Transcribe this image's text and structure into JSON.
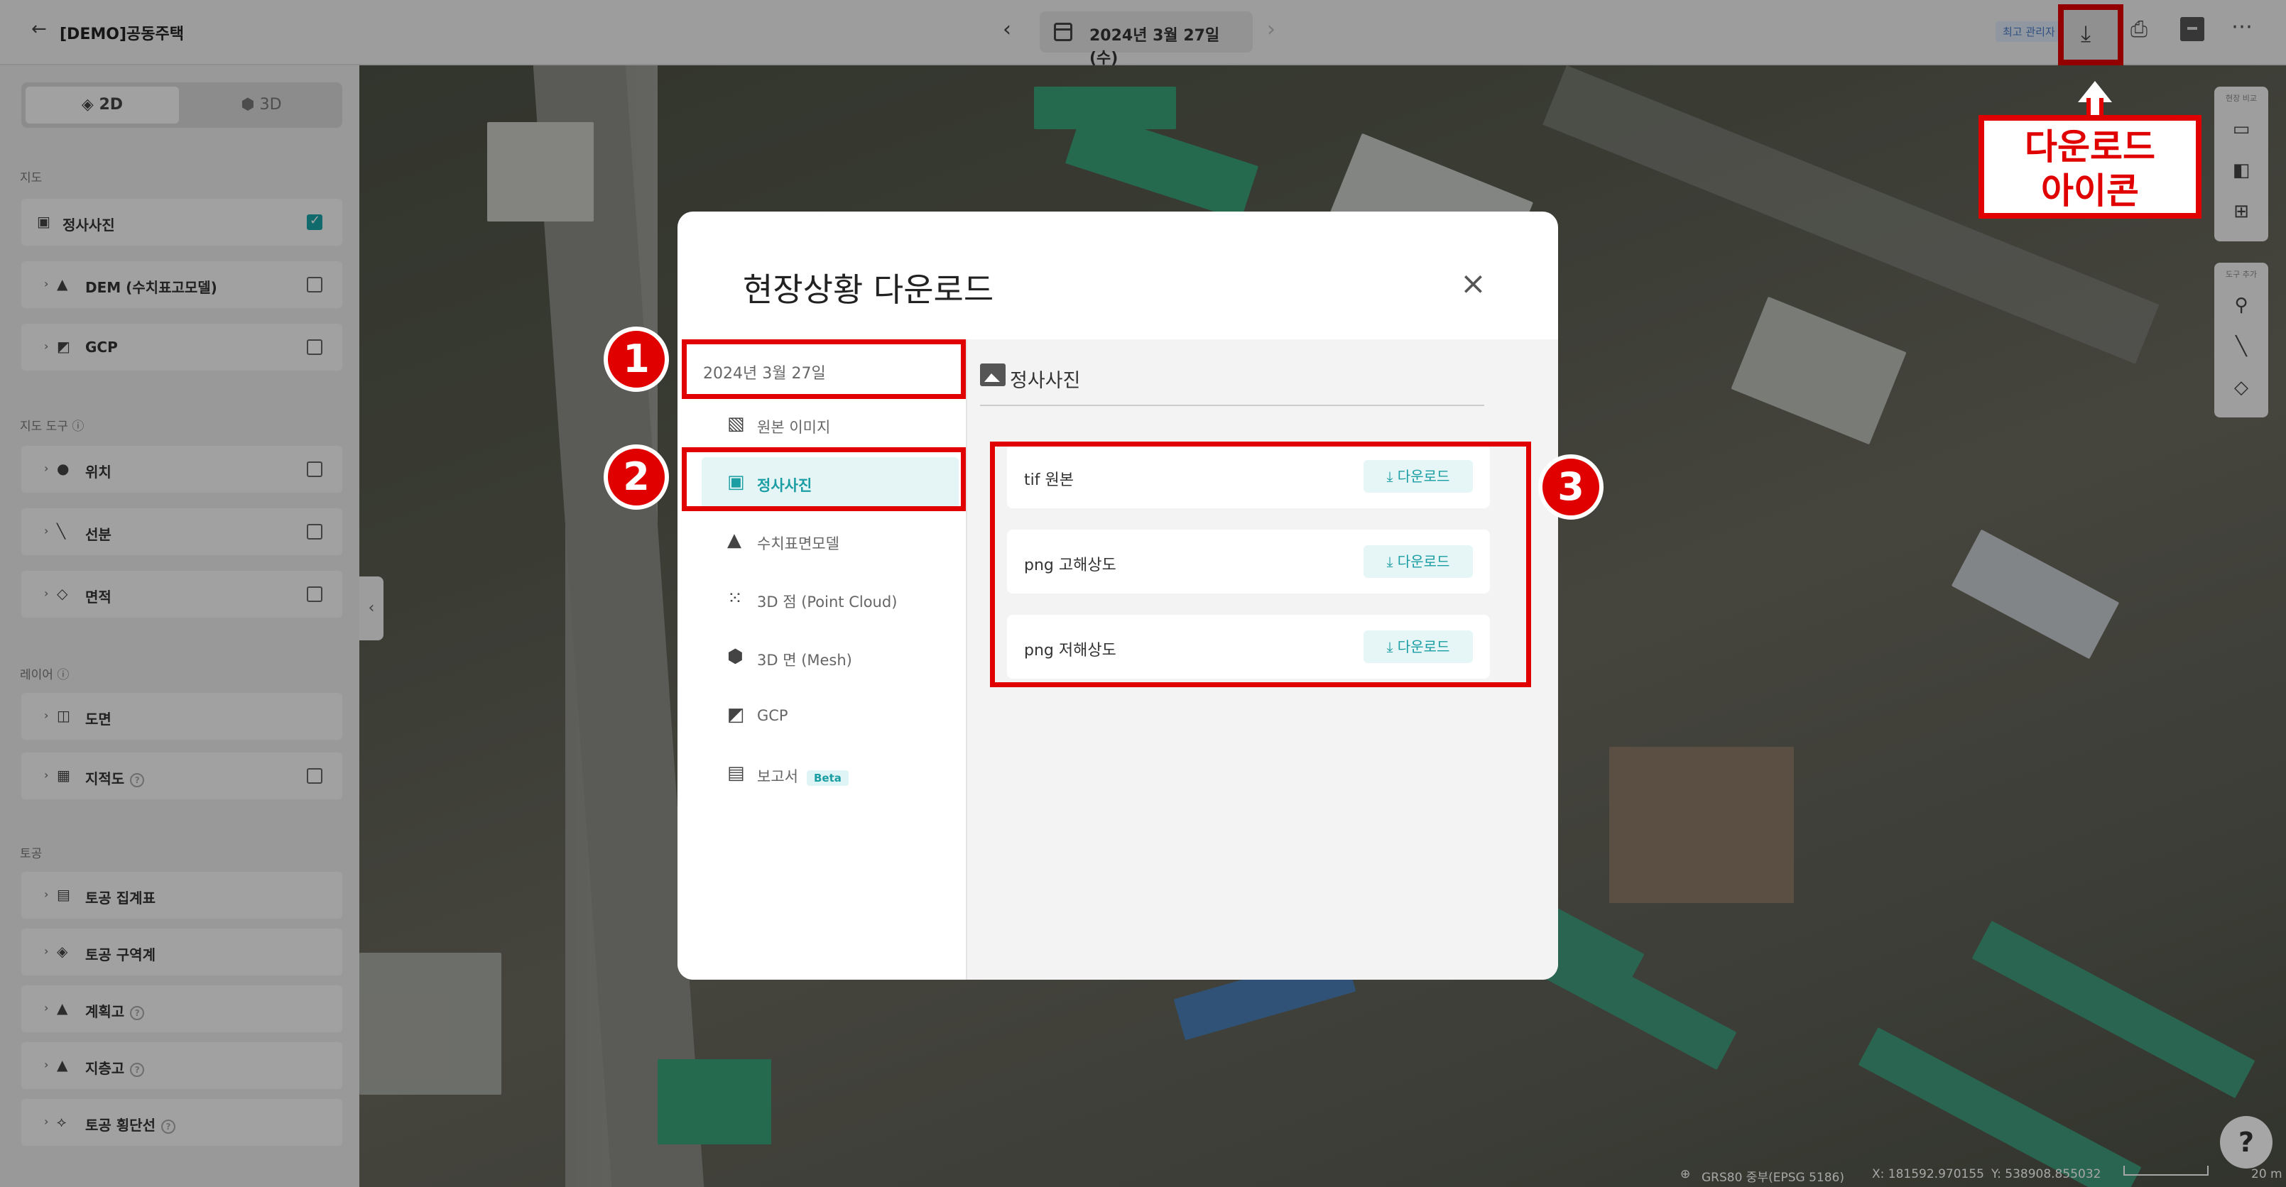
{
  "topbar": {
    "back_icon": "arrow-left-icon",
    "project_title": "[DEMO]공동주택",
    "date": "2024년 3월 27일 (수)",
    "chip": "최고 관리자"
  },
  "callout": {
    "line1": "다운로드",
    "line2": "아이콘"
  },
  "sidebar": {
    "view_2d": "2D",
    "view_3d": "3D",
    "map_section": "지도",
    "map_items": [
      {
        "label": "정사사진",
        "checked": true
      },
      {
        "label": "DEM (수치표고모델)",
        "checked": false
      },
      {
        "label": "GCP",
        "checked": false
      }
    ],
    "tools_section": "지도 도구",
    "tool_items": [
      {
        "label": "위치"
      },
      {
        "label": "선분"
      },
      {
        "label": "면적"
      }
    ],
    "layer_section": "레이어",
    "layer_items": [
      {
        "label": "도면"
      },
      {
        "label": "지적도"
      }
    ],
    "earthwork_section": "토공",
    "earthwork_items": [
      {
        "label": "토공 집계표"
      },
      {
        "label": "토공 구역계"
      },
      {
        "label": "계획고"
      },
      {
        "label": "지층고"
      },
      {
        "label": "토공 횡단선"
      }
    ]
  },
  "right_tools": {
    "compare_title": "현장 비교",
    "tool_title": "도구 추가"
  },
  "modal": {
    "title": "현장상황 다운로드",
    "date": "2024년 3월 27일",
    "nav": [
      {
        "label": "원본 이미지",
        "icon": "images-icon"
      },
      {
        "label": "정사사진",
        "icon": "image-icon",
        "active": true
      },
      {
        "label": "수치표면모델",
        "icon": "mountain-icon"
      },
      {
        "label": "3D 점 (Point Cloud)",
        "icon": "point-cloud-icon"
      },
      {
        "label": "3D 면 (Mesh)",
        "icon": "cube-icon"
      },
      {
        "label": "GCP",
        "icon": "gcp-icon"
      },
      {
        "label": "보고서",
        "icon": "document-icon",
        "badge": "Beta"
      }
    ],
    "section_title": "정사사진",
    "files": [
      {
        "name": "tif 원본",
        "button": "다운로드"
      },
      {
        "name": "png 고해상도",
        "button": "다운로드"
      },
      {
        "name": "png 저해상도",
        "button": "다운로드"
      }
    ]
  },
  "annotations": {
    "n1": "1",
    "n2": "2",
    "n3": "3"
  },
  "status": {
    "crs": "GRS80 중부(EPSG 5186)",
    "x": "X: 181592.970155",
    "y": "Y: 538908.855032",
    "scale": "20 m"
  },
  "help_label": "?",
  "colors": {
    "accent": "#1a9ea3",
    "annotation_red": "#e00000"
  }
}
